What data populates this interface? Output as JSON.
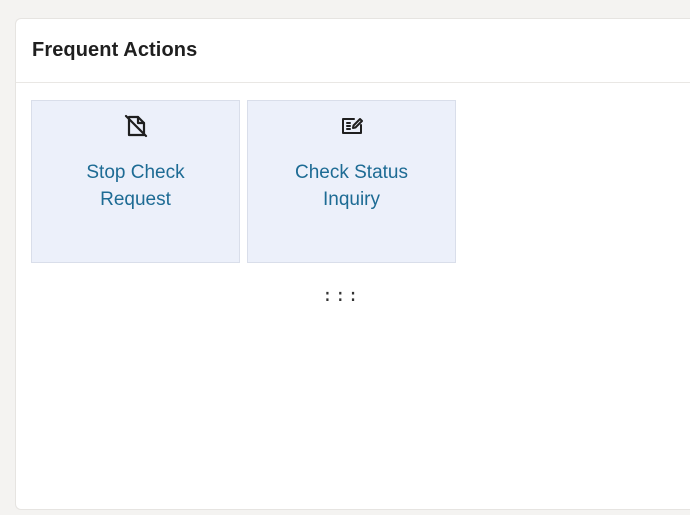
{
  "widget": {
    "title": "Frequent Actions",
    "drag_handle": ":::"
  },
  "actions": [
    {
      "label": "Stop Check Request",
      "icon": "stop-check-document-icon"
    },
    {
      "label": "Check Status Inquiry",
      "icon": "check-status-edit-icon"
    }
  ],
  "colors": {
    "tile_background": "#ecf0fa",
    "tile_label": "#1d6b94",
    "title_text": "#1f1f1f"
  }
}
